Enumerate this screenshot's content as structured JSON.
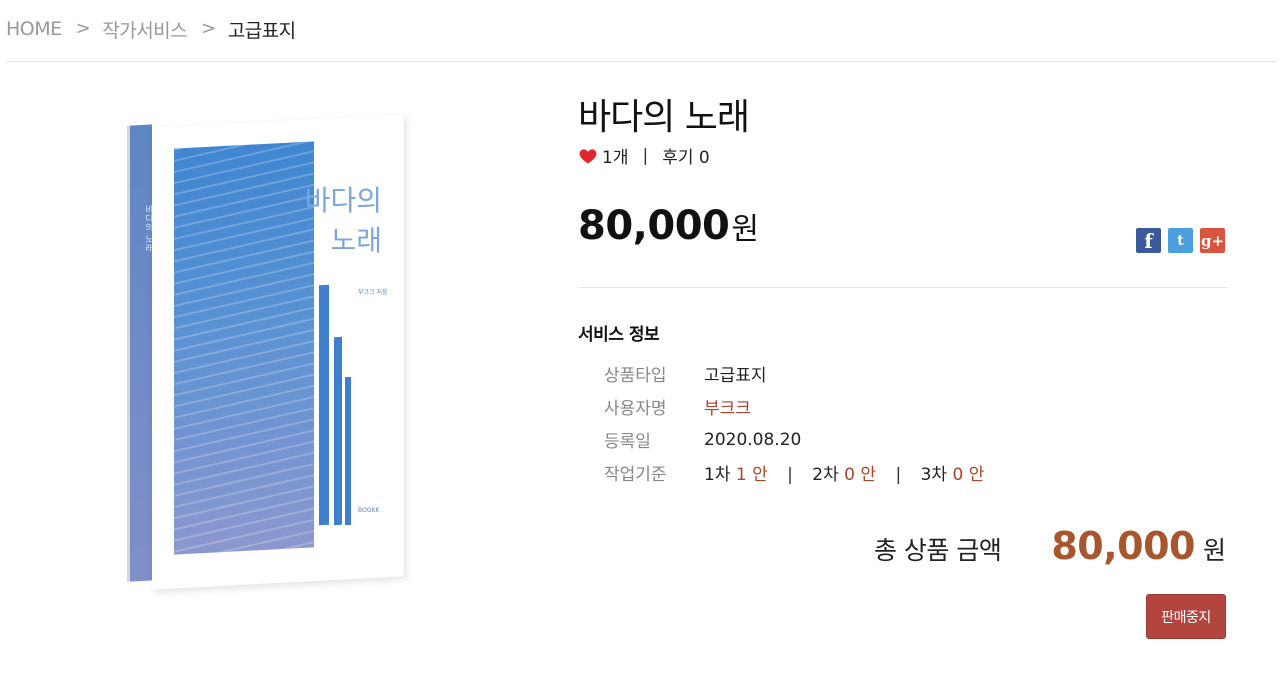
{
  "breadcrumb": {
    "home": "HOME",
    "level1": "작가서비스",
    "current": "고급표지",
    "separator": ">"
  },
  "product": {
    "title": "바다의 노래",
    "likes": "1개",
    "divider": "|",
    "reviews": "후기 0",
    "price_number": "80,000",
    "price_unit": "원"
  },
  "cover": {
    "title_line1": "바다의",
    "title_line2": "노래",
    "author": "부크크 지음",
    "spine_text": "바다의 노래",
    "publisher": "BOOKK"
  },
  "social": {
    "facebook_label": "f",
    "twitter_label": "t",
    "googleplus_label": "g+",
    "colors": {
      "facebook": "#3b5a99",
      "twitter": "#4a9fdc",
      "googleplus": "#d9543c"
    }
  },
  "service_info": {
    "heading": "서비스 정보",
    "rows": [
      {
        "label": "상품타입",
        "value": "고급표지"
      },
      {
        "label": "사용자명",
        "value": "부크크"
      },
      {
        "label": "등록일",
        "value": "2020.08.20"
      },
      {
        "label": "작업기준"
      }
    ],
    "work": [
      {
        "round": "1차",
        "count": "1",
        "unit": "안"
      },
      {
        "round": "2차",
        "count": "0",
        "unit": "안"
      },
      {
        "round": "3차",
        "count": "0",
        "unit": "안"
      }
    ]
  },
  "total": {
    "label": "총 상품 금액",
    "amount": "80,000",
    "unit": "원"
  },
  "actions": {
    "stop_sale": "판매중지"
  },
  "colors": {
    "accent": "#a7562e",
    "stop_button": "#b3453f",
    "heart": "#e0262e"
  }
}
